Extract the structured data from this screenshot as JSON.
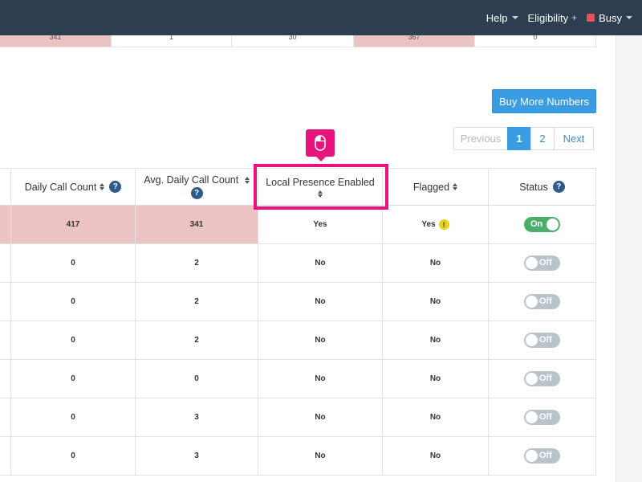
{
  "nav": {
    "help": "Help",
    "eligibility": "Eligibility",
    "status": "Busy",
    "status_color": "#e8505b"
  },
  "top_row": [
    "341",
    "1",
    "30",
    "367",
    "0"
  ],
  "buy_button": "Buy More Numbers",
  "pagination": {
    "prev": "Previous",
    "pages": [
      "1",
      "2"
    ],
    "next": "Next",
    "current": "1"
  },
  "table": {
    "headers": {
      "daily": "Daily Call Count",
      "avg": "Avg. Daily Call Count",
      "local": "Local Presence Enabled",
      "flagged": "Flagged",
      "status": "Status"
    },
    "help_glyph": "?",
    "rows": [
      {
        "daily": "417",
        "avg": "341",
        "local": "Yes",
        "flagged": "Yes",
        "status": "On",
        "highlight": true,
        "warn": "!"
      },
      {
        "daily": "0",
        "avg": "2",
        "local": "No",
        "flagged": "No",
        "status": "Off"
      },
      {
        "daily": "0",
        "avg": "2",
        "local": "No",
        "flagged": "No",
        "status": "Off"
      },
      {
        "daily": "0",
        "avg": "2",
        "local": "No",
        "flagged": "No",
        "status": "Off"
      },
      {
        "daily": "0",
        "avg": "0",
        "local": "No",
        "flagged": "No",
        "status": "Off"
      },
      {
        "daily": "0",
        "avg": "3",
        "local": "No",
        "flagged": "No",
        "status": "Off"
      },
      {
        "daily": "0",
        "avg": "3",
        "local": "No",
        "flagged": "No",
        "status": "Off"
      }
    ]
  },
  "colors": {
    "navbar": "#2d3e50",
    "primary": "#3a9de3",
    "highlight_row": "#ebc3c3",
    "toggle_on": "#4cae6a",
    "toggle_off": "#b8c3ce",
    "annotation": "#e8137d"
  },
  "icons": {
    "cursor": "mouse-icon",
    "help": "help-circle-icon",
    "warn": "warning-icon"
  }
}
